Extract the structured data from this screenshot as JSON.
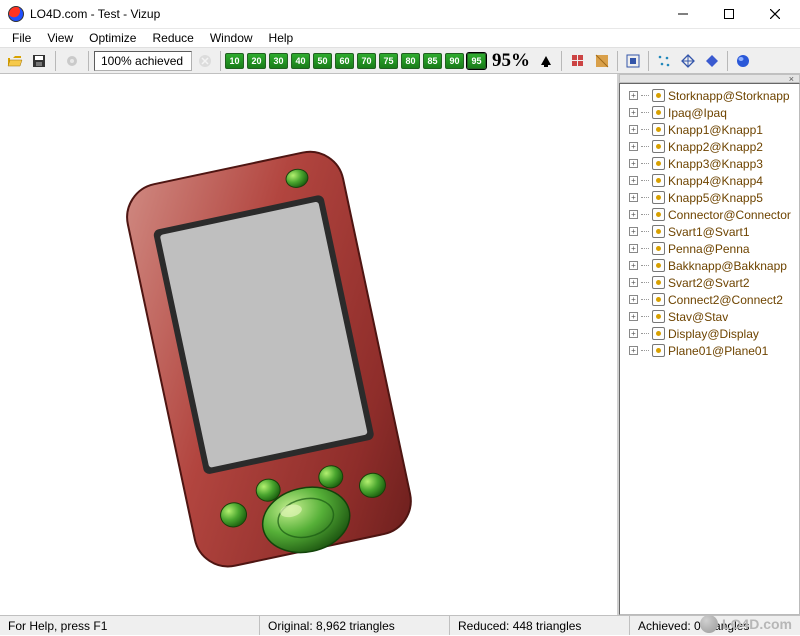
{
  "window": {
    "title": "LO4D.com - Test - Vizup"
  },
  "menu": {
    "items": [
      "File",
      "View",
      "Optimize",
      "Reduce",
      "Window",
      "Help"
    ]
  },
  "toolbar": {
    "achieved_label": "100% achieved",
    "levels": [
      "10",
      "20",
      "30",
      "40",
      "50",
      "60",
      "70",
      "75",
      "80",
      "85",
      "90",
      "95"
    ],
    "selected_level_idx": 11,
    "current_pct": "95%"
  },
  "icons": {
    "open": "open-icon",
    "save": "save-icon",
    "gear": "gear-icon",
    "cancel": "cancel-icon",
    "up": "arrow-up-icon",
    "grid1": "shading-flat-icon",
    "grid2": "shading-shaded-icon",
    "fit": "fit-view-icon",
    "d1": "points-icon",
    "d2": "wireframe-icon",
    "d3": "solid-icon",
    "d4": "smooth-icon"
  },
  "tree": {
    "items": [
      "Storknapp@Storknapp",
      "Ipaq@Ipaq",
      "Knapp1@Knapp1",
      "Knapp2@Knapp2",
      "Knapp3@Knapp3",
      "Knapp4@Knapp4",
      "Knapp5@Knapp5",
      "Connector@Connector",
      "Svart1@Svart1",
      "Penna@Penna",
      "Bakknapp@Bakknapp",
      "Svart2@Svart2",
      "Connect2@Connect2",
      "Stav@Stav",
      "Display@Display",
      "Plane01@Plane01"
    ]
  },
  "status": {
    "help": "For Help, press F1",
    "original": "Original: 8,962 triangles",
    "reduced": "Reduced: 448 triangles",
    "achieved": "Achieved: 0 triangles"
  },
  "watermark": "LO4D.com"
}
